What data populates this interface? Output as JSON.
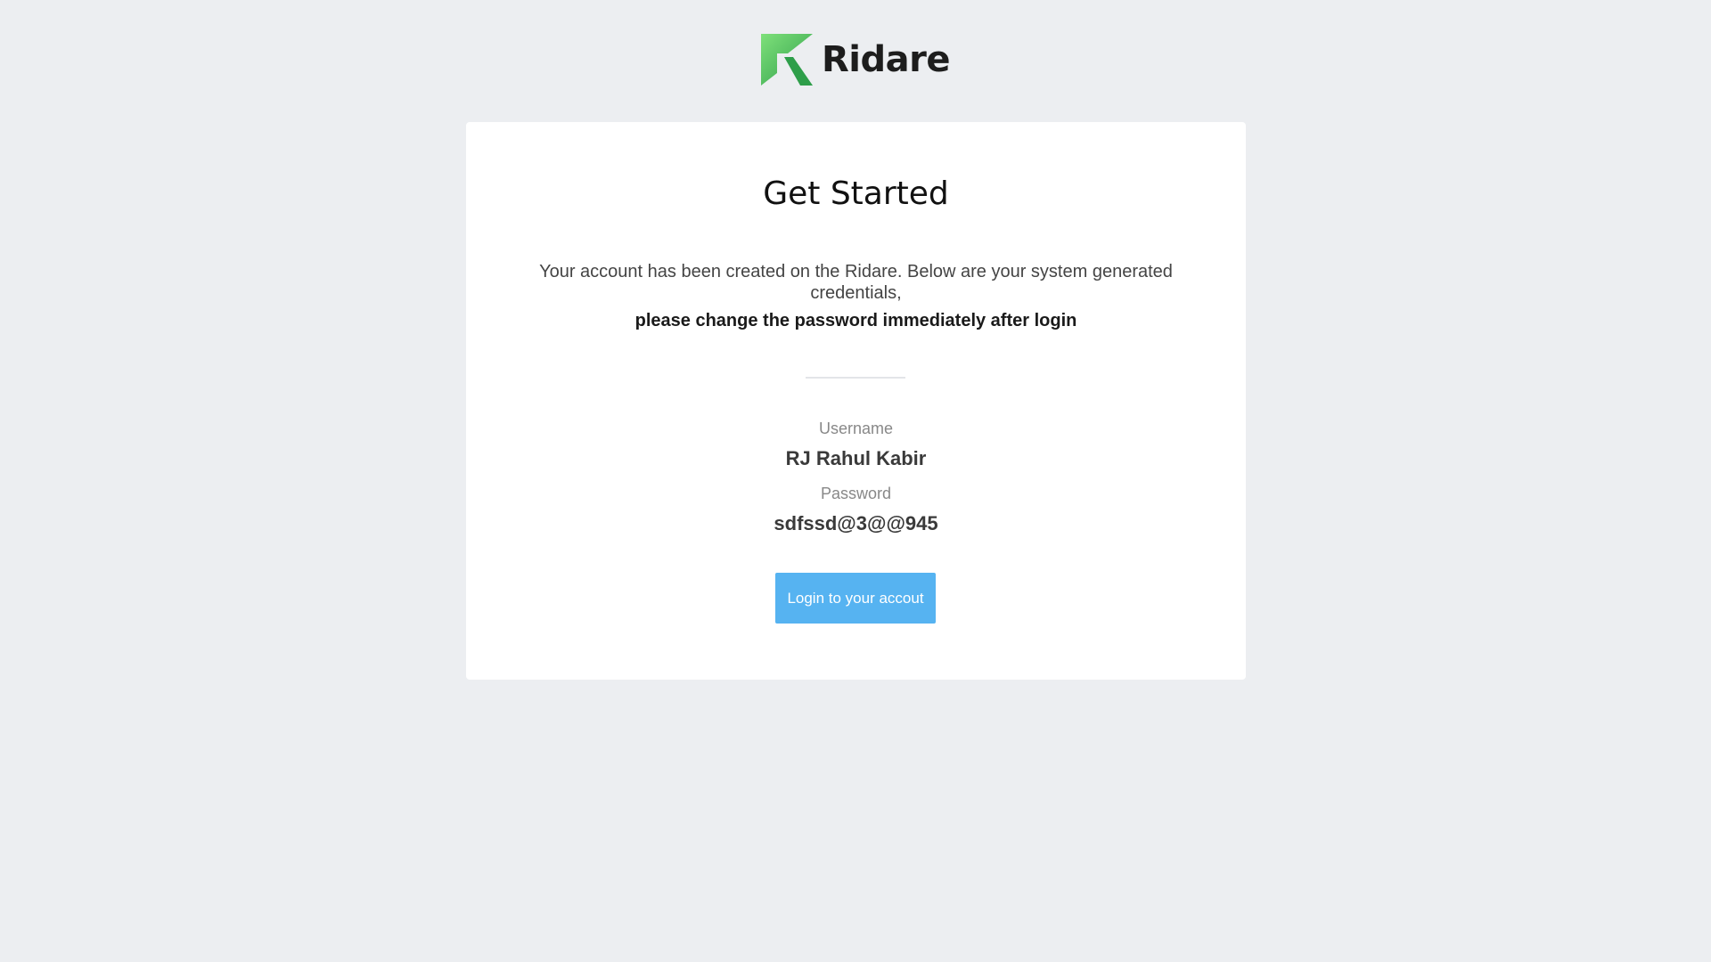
{
  "brand": {
    "name": "Ridare",
    "logo_icon": "ridare-logo-icon",
    "colors": {
      "logo_light": "#6cd86a",
      "logo_dark": "#2e9e4a"
    }
  },
  "card": {
    "title": "Get Started",
    "intro": "Your account has been created on the Ridare. Below are your system generated credentials,",
    "warning": "please change the password immediately after login",
    "username_label": "Username",
    "username_value": "RJ Rahul Kabir",
    "password_label": "Password",
    "password_value": "sdfssd@3@@945",
    "login_button": "Login to your accout"
  },
  "colors": {
    "background": "#eceef1",
    "card": "#ffffff",
    "button": "#56b3f1",
    "button_text": "#ffffff"
  }
}
